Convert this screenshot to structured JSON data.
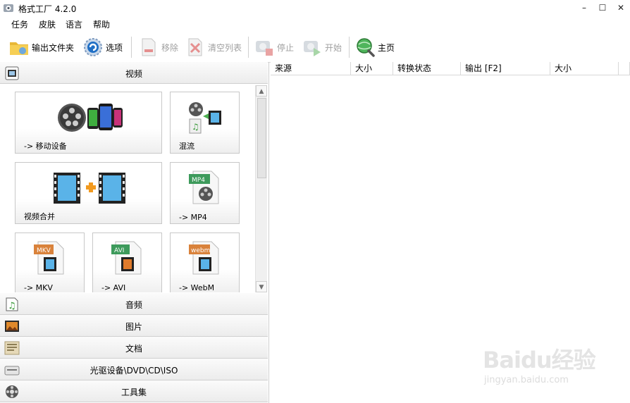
{
  "window": {
    "title": "格式工厂 4.2.0",
    "minimize": "–",
    "maximize": "☐",
    "close": "✕"
  },
  "menu": [
    "任务",
    "皮肤",
    "语言",
    "帮助"
  ],
  "toolbar": {
    "output_folder": "输出文件夹",
    "options": "选项",
    "remove": "移除",
    "clear_list": "清空列表",
    "stop": "停止",
    "start": "开始",
    "home": "主页"
  },
  "categories": {
    "video": "视频",
    "audio": "音频",
    "picture": "图片",
    "document": "文档",
    "rom": "光驱设备\\DVD\\CD\\ISO",
    "tools": "工具集"
  },
  "tiles": {
    "mobile": "-> 移动设备",
    "mux": "混流",
    "join": "视频合并",
    "mp4": "-> MP4",
    "mkv": "-> MKV",
    "avi": "-> AVI",
    "webm": "-> WebM",
    "mp4_badge": "MP4",
    "mkv_badge": "MKV",
    "avi_badge": "AVI",
    "webm_badge": "webm"
  },
  "task_list": {
    "columns": [
      "来源",
      "大小",
      "转换状态",
      "输出 [F2]",
      "大小"
    ]
  },
  "watermark": {
    "logo": "Baidu经验",
    "url": "jingyan.baidu.com"
  }
}
